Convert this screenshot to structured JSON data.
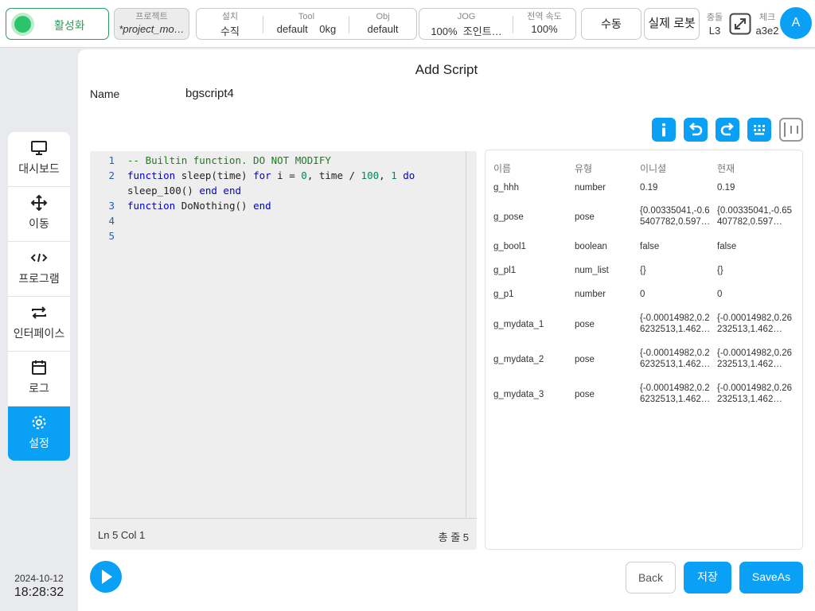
{
  "topbar": {
    "activate_label": "활성화",
    "project_label": "프로젝트",
    "project_value": "*project_mo…",
    "install_label": "설치",
    "install_value": "수직",
    "tool_label": "Tool",
    "tool_value": "default",
    "tool_weight": "0kg",
    "obj_label": "Obj",
    "obj_value": "default",
    "jog_label": "JOG",
    "jog_value": "100%",
    "jog_mode": "조인트…",
    "speed_label": "전역 속도",
    "speed_value": "100%",
    "manual_label": "수동",
    "robot_label": "실제 로봇",
    "collision_label": "충돌",
    "collision_value": "L3",
    "check_label": "체크",
    "check_value": "a3e2",
    "avatar_letter": "A"
  },
  "sidebar": {
    "items": [
      {
        "label": "대시보드",
        "icon": "monitor-icon"
      },
      {
        "label": "이동",
        "icon": "move-icon"
      },
      {
        "label": "프로그램",
        "icon": "code-icon"
      },
      {
        "label": "인터페이스",
        "icon": "interface-icon"
      },
      {
        "label": "로그",
        "icon": "calendar-icon"
      },
      {
        "label": "설정",
        "icon": "gear-icon",
        "active": true
      }
    ],
    "date": "2024-10-12",
    "time": "18:28:32"
  },
  "main": {
    "title": "Add Script",
    "name_label": "Name",
    "name_value": "bgscript4"
  },
  "editor": {
    "lines": [
      {
        "n": "1",
        "text": "-- Builtin function. DO NOT MODIFY"
      },
      {
        "n": "2",
        "text": "function sleep(time) for i = 0, time / 100, 1 do"
      },
      {
        "n": "",
        "text": "sleep_100() end end"
      },
      {
        "n": "3",
        "text": "function DoNothing() end"
      },
      {
        "n": "4",
        "text": ""
      },
      {
        "n": "5",
        "text": ""
      }
    ],
    "cursor_status": "Ln 5 Col 1",
    "total_lines": "총 줄 5"
  },
  "variables": {
    "headers": [
      "이름",
      "유형",
      "이니셜",
      "현재"
    ],
    "rows": [
      {
        "name": "g_hhh",
        "type": "number",
        "initial": "0.19",
        "current": "0.19"
      },
      {
        "name": "g_pose",
        "type": "pose",
        "initial": "{0.00335041,-0.65407782,0.597…",
        "current": "{0.00335041,-0.65407782,0.597…"
      },
      {
        "name": "g_bool1",
        "type": "boolean",
        "initial": "false",
        "current": "false"
      },
      {
        "name": "g_pl1",
        "type": "num_list",
        "initial": "{}",
        "current": "{}"
      },
      {
        "name": "g_p1",
        "type": "number",
        "initial": "0",
        "current": "0"
      },
      {
        "name": "g_mydata_1",
        "type": "pose",
        "initial": "{-0.00014982,0.26232513,1.462…",
        "current": "{-0.00014982,0.26232513,1.462…"
      },
      {
        "name": "g_mydata_2",
        "type": "pose",
        "initial": "{-0.00014982,0.26232513,1.462…",
        "current": "{-0.00014982,0.26232513,1.462…"
      },
      {
        "name": "g_mydata_3",
        "type": "pose",
        "initial": "{-0.00014982,0.26232513,1.462…",
        "current": "{-0.00014982,0.26232513,1.462…"
      }
    ]
  },
  "footer": {
    "back_label": "Back",
    "save_label": "저장",
    "saveas_label": "SaveAs"
  },
  "colors": {
    "accent": "#0aa0f5",
    "active_green": "#2cc46b"
  }
}
